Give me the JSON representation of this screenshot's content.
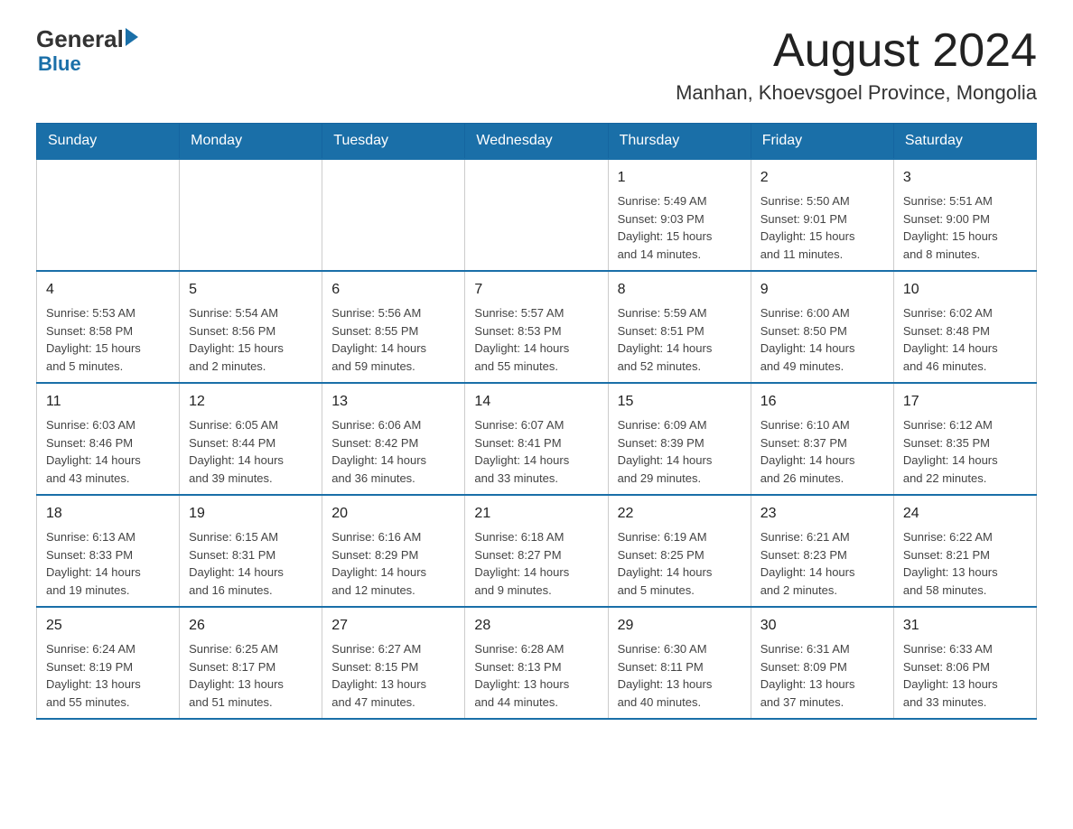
{
  "logo": {
    "general": "General",
    "blue": "Blue"
  },
  "header": {
    "month": "August 2024",
    "location": "Manhan, Khoevsgoel Province, Mongolia"
  },
  "weekdays": [
    "Sunday",
    "Monday",
    "Tuesday",
    "Wednesday",
    "Thursday",
    "Friday",
    "Saturday"
  ],
  "weeks": [
    [
      {
        "day": "",
        "info": ""
      },
      {
        "day": "",
        "info": ""
      },
      {
        "day": "",
        "info": ""
      },
      {
        "day": "",
        "info": ""
      },
      {
        "day": "1",
        "info": "Sunrise: 5:49 AM\nSunset: 9:03 PM\nDaylight: 15 hours\nand 14 minutes."
      },
      {
        "day": "2",
        "info": "Sunrise: 5:50 AM\nSunset: 9:01 PM\nDaylight: 15 hours\nand 11 minutes."
      },
      {
        "day": "3",
        "info": "Sunrise: 5:51 AM\nSunset: 9:00 PM\nDaylight: 15 hours\nand 8 minutes."
      }
    ],
    [
      {
        "day": "4",
        "info": "Sunrise: 5:53 AM\nSunset: 8:58 PM\nDaylight: 15 hours\nand 5 minutes."
      },
      {
        "day": "5",
        "info": "Sunrise: 5:54 AM\nSunset: 8:56 PM\nDaylight: 15 hours\nand 2 minutes."
      },
      {
        "day": "6",
        "info": "Sunrise: 5:56 AM\nSunset: 8:55 PM\nDaylight: 14 hours\nand 59 minutes."
      },
      {
        "day": "7",
        "info": "Sunrise: 5:57 AM\nSunset: 8:53 PM\nDaylight: 14 hours\nand 55 minutes."
      },
      {
        "day": "8",
        "info": "Sunrise: 5:59 AM\nSunset: 8:51 PM\nDaylight: 14 hours\nand 52 minutes."
      },
      {
        "day": "9",
        "info": "Sunrise: 6:00 AM\nSunset: 8:50 PM\nDaylight: 14 hours\nand 49 minutes."
      },
      {
        "day": "10",
        "info": "Sunrise: 6:02 AM\nSunset: 8:48 PM\nDaylight: 14 hours\nand 46 minutes."
      }
    ],
    [
      {
        "day": "11",
        "info": "Sunrise: 6:03 AM\nSunset: 8:46 PM\nDaylight: 14 hours\nand 43 minutes."
      },
      {
        "day": "12",
        "info": "Sunrise: 6:05 AM\nSunset: 8:44 PM\nDaylight: 14 hours\nand 39 minutes."
      },
      {
        "day": "13",
        "info": "Sunrise: 6:06 AM\nSunset: 8:42 PM\nDaylight: 14 hours\nand 36 minutes."
      },
      {
        "day": "14",
        "info": "Sunrise: 6:07 AM\nSunset: 8:41 PM\nDaylight: 14 hours\nand 33 minutes."
      },
      {
        "day": "15",
        "info": "Sunrise: 6:09 AM\nSunset: 8:39 PM\nDaylight: 14 hours\nand 29 minutes."
      },
      {
        "day": "16",
        "info": "Sunrise: 6:10 AM\nSunset: 8:37 PM\nDaylight: 14 hours\nand 26 minutes."
      },
      {
        "day": "17",
        "info": "Sunrise: 6:12 AM\nSunset: 8:35 PM\nDaylight: 14 hours\nand 22 minutes."
      }
    ],
    [
      {
        "day": "18",
        "info": "Sunrise: 6:13 AM\nSunset: 8:33 PM\nDaylight: 14 hours\nand 19 minutes."
      },
      {
        "day": "19",
        "info": "Sunrise: 6:15 AM\nSunset: 8:31 PM\nDaylight: 14 hours\nand 16 minutes."
      },
      {
        "day": "20",
        "info": "Sunrise: 6:16 AM\nSunset: 8:29 PM\nDaylight: 14 hours\nand 12 minutes."
      },
      {
        "day": "21",
        "info": "Sunrise: 6:18 AM\nSunset: 8:27 PM\nDaylight: 14 hours\nand 9 minutes."
      },
      {
        "day": "22",
        "info": "Sunrise: 6:19 AM\nSunset: 8:25 PM\nDaylight: 14 hours\nand 5 minutes."
      },
      {
        "day": "23",
        "info": "Sunrise: 6:21 AM\nSunset: 8:23 PM\nDaylight: 14 hours\nand 2 minutes."
      },
      {
        "day": "24",
        "info": "Sunrise: 6:22 AM\nSunset: 8:21 PM\nDaylight: 13 hours\nand 58 minutes."
      }
    ],
    [
      {
        "day": "25",
        "info": "Sunrise: 6:24 AM\nSunset: 8:19 PM\nDaylight: 13 hours\nand 55 minutes."
      },
      {
        "day": "26",
        "info": "Sunrise: 6:25 AM\nSunset: 8:17 PM\nDaylight: 13 hours\nand 51 minutes."
      },
      {
        "day": "27",
        "info": "Sunrise: 6:27 AM\nSunset: 8:15 PM\nDaylight: 13 hours\nand 47 minutes."
      },
      {
        "day": "28",
        "info": "Sunrise: 6:28 AM\nSunset: 8:13 PM\nDaylight: 13 hours\nand 44 minutes."
      },
      {
        "day": "29",
        "info": "Sunrise: 6:30 AM\nSunset: 8:11 PM\nDaylight: 13 hours\nand 40 minutes."
      },
      {
        "day": "30",
        "info": "Sunrise: 6:31 AM\nSunset: 8:09 PM\nDaylight: 13 hours\nand 37 minutes."
      },
      {
        "day": "31",
        "info": "Sunrise: 6:33 AM\nSunset: 8:06 PM\nDaylight: 13 hours\nand 33 minutes."
      }
    ]
  ]
}
